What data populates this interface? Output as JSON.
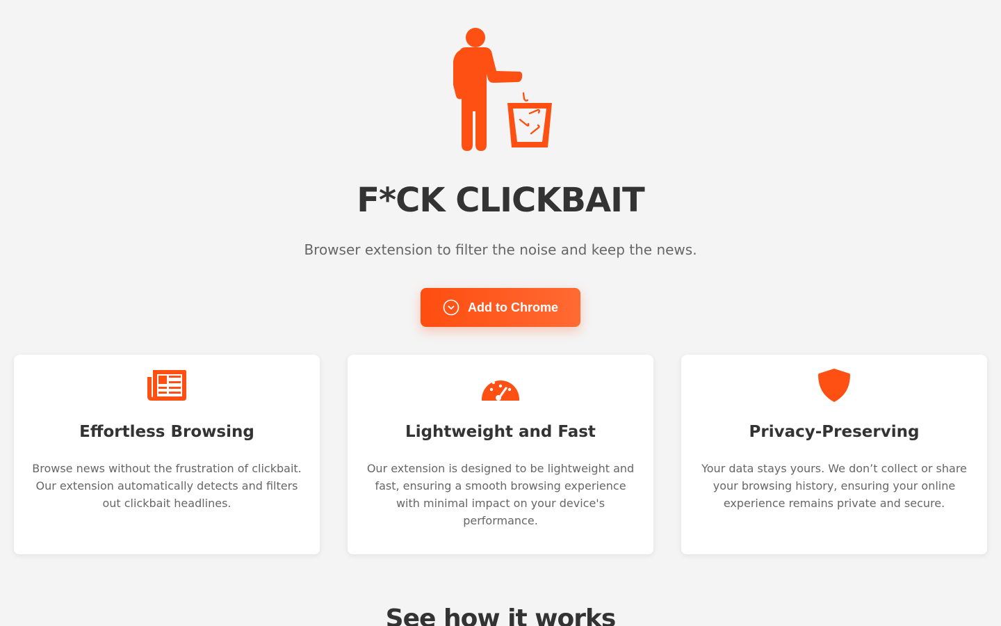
{
  "hero": {
    "title": "F*CK CLICKBAIT",
    "subtitle": "Browser extension to filter the noise and keep the news.",
    "logo_icon": "person-trash-icon"
  },
  "cta": {
    "label": "Add to Chrome",
    "icon": "chevron-circle-down-icon"
  },
  "features": [
    {
      "icon": "newspaper-icon",
      "title": "Effortless Browsing",
      "text": "Browse news without the frustration of clickbait. Our extension automatically detects and filters out clickbait headlines."
    },
    {
      "icon": "speedometer-icon",
      "title": "Lightweight and Fast",
      "text": "Our extension is designed to be lightweight and fast, ensuring a smooth browsing experience with minimal impact on your device's performance."
    },
    {
      "icon": "shield-icon",
      "title": "Privacy-Preserving",
      "text": "Your data stays yours. We don’t collect or share your browsing history, ensuring your online experience remains private and secure."
    }
  ],
  "how_it_works": {
    "title": "See how it works"
  },
  "colors": {
    "accent": "#ff5014",
    "background": "#f4f4f4",
    "text": "#333333",
    "muted": "#666666"
  }
}
